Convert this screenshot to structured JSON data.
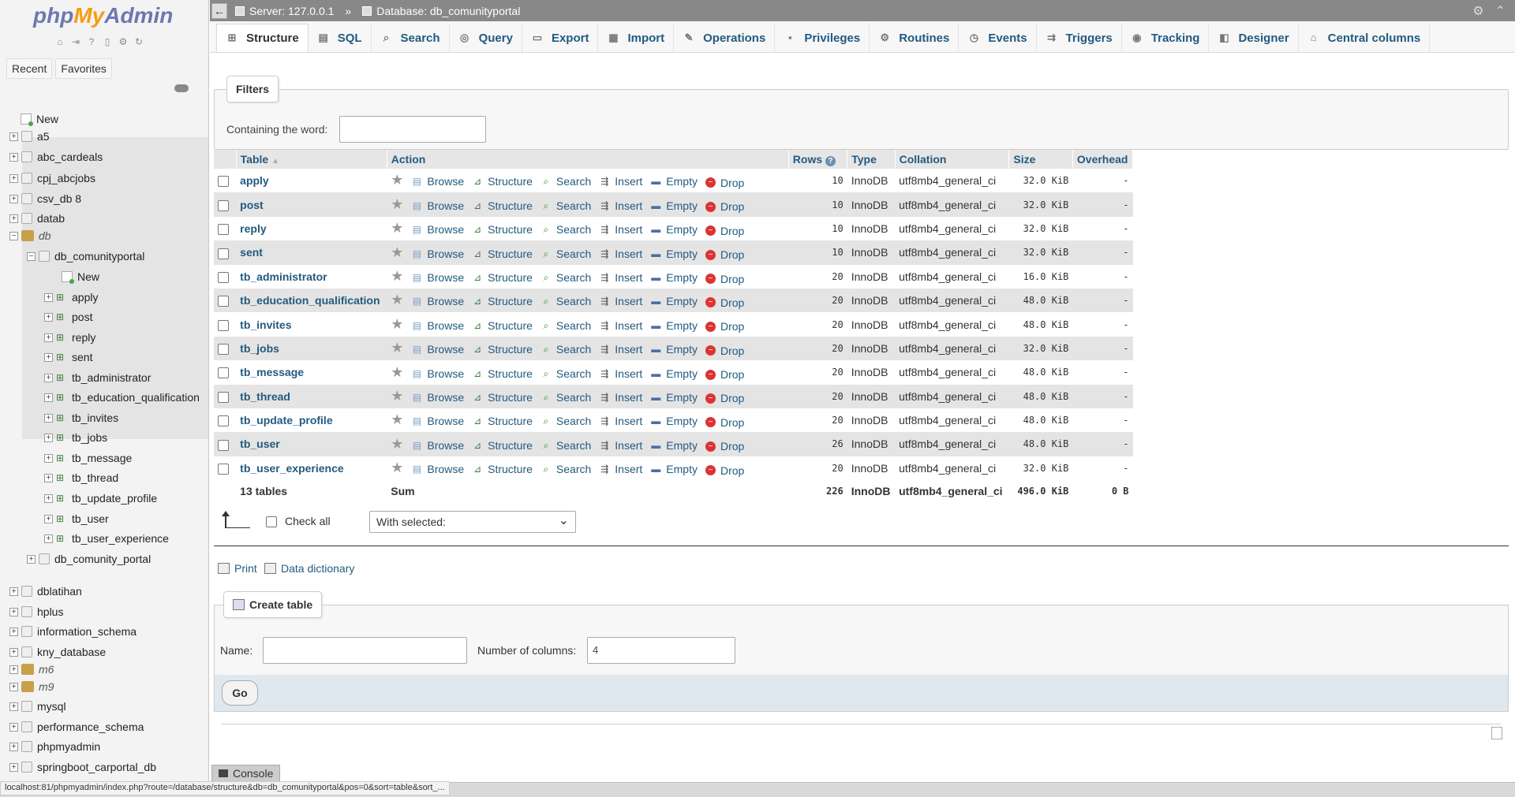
{
  "logo": {
    "part1": "php",
    "part2": "My",
    "part3": "Admin"
  },
  "sidebar": {
    "tabs": [
      "Recent",
      "Favorites"
    ],
    "tree": [
      {
        "label": "New",
        "kind": "new",
        "level": 0
      },
      {
        "label": "a5",
        "kind": "db",
        "level": 0
      },
      {
        "label": "abc_cardeals",
        "kind": "db",
        "level": 0
      },
      {
        "label": "cpj_abcjobs",
        "kind": "db",
        "level": 0
      },
      {
        "label": "csv_db 8",
        "kind": "db",
        "level": 0
      },
      {
        "label": "datab",
        "kind": "db",
        "level": 0
      },
      {
        "label": "db",
        "kind": "group",
        "level": 0
      },
      {
        "label": "db_comunityportal",
        "kind": "db-open",
        "level": 1
      },
      {
        "label": "New",
        "kind": "new",
        "level": 2
      },
      {
        "label": "apply",
        "kind": "table",
        "level": 2
      },
      {
        "label": "post",
        "kind": "table",
        "level": 2
      },
      {
        "label": "reply",
        "kind": "table",
        "level": 2
      },
      {
        "label": "sent",
        "kind": "table",
        "level": 2
      },
      {
        "label": "tb_administrator",
        "kind": "table",
        "level": 2
      },
      {
        "label": "tb_education_qualification",
        "kind": "table",
        "level": 2
      },
      {
        "label": "tb_invites",
        "kind": "table",
        "level": 2
      },
      {
        "label": "tb_jobs",
        "kind": "table",
        "level": 2
      },
      {
        "label": "tb_message",
        "kind": "table",
        "level": 2
      },
      {
        "label": "tb_thread",
        "kind": "table",
        "level": 2
      },
      {
        "label": "tb_update_profile",
        "kind": "table",
        "level": 2
      },
      {
        "label": "tb_user",
        "kind": "table",
        "level": 2
      },
      {
        "label": "tb_user_experience",
        "kind": "table",
        "level": 2
      },
      {
        "label": "db_comunity_portal",
        "kind": "db",
        "level": 1
      },
      {
        "label": "dblatihan",
        "kind": "db",
        "level": 0
      },
      {
        "label": "hplus",
        "kind": "db",
        "level": 0
      },
      {
        "label": "information_schema",
        "kind": "db",
        "level": 0
      },
      {
        "label": "kny_database",
        "kind": "db",
        "level": 0
      },
      {
        "label": "m6",
        "kind": "group",
        "level": 0
      },
      {
        "label": "m9",
        "kind": "group",
        "level": 0
      },
      {
        "label": "mysql",
        "kind": "db",
        "level": 0
      },
      {
        "label": "performance_schema",
        "kind": "db",
        "level": 0
      },
      {
        "label": "phpmyadmin",
        "kind": "db",
        "level": 0
      },
      {
        "label": "springboot_carportal_db",
        "kind": "db",
        "level": 0
      }
    ]
  },
  "topbar": {
    "server": "Server: 127.0.0.1",
    "separator": "»",
    "database": "Database: db_comunityportal"
  },
  "tabs": [
    {
      "label": "Structure",
      "icon": "structure-icon",
      "glyph": "⊞"
    },
    {
      "label": "SQL",
      "icon": "sql-icon",
      "glyph": "▤"
    },
    {
      "label": "Search",
      "icon": "search-icon",
      "glyph": "⌕"
    },
    {
      "label": "Query",
      "icon": "query-icon",
      "glyph": "◎"
    },
    {
      "label": "Export",
      "icon": "export-icon",
      "glyph": "▭"
    },
    {
      "label": "Import",
      "icon": "import-icon",
      "glyph": "▦"
    },
    {
      "label": "Operations",
      "icon": "wrench-icon",
      "glyph": "✎"
    },
    {
      "label": "Privileges",
      "icon": "privileges-icon",
      "glyph": "▪"
    },
    {
      "label": "Routines",
      "icon": "routines-icon",
      "glyph": "⚙"
    },
    {
      "label": "Events",
      "icon": "clock-icon",
      "glyph": "◷"
    },
    {
      "label": "Triggers",
      "icon": "triggers-icon",
      "glyph": "⇉"
    },
    {
      "label": "Tracking",
      "icon": "eye-icon",
      "glyph": "◉"
    },
    {
      "label": "Designer",
      "icon": "designer-icon",
      "glyph": "◧"
    },
    {
      "label": "Central columns",
      "icon": "central-columns-icon",
      "glyph": "⌂"
    }
  ],
  "filters": {
    "legend": "Filters",
    "label": "Containing the word:",
    "value": ""
  },
  "table": {
    "headers": {
      "table": "Table",
      "action": "Action",
      "rows": "Rows",
      "type": "Type",
      "collation": "Collation",
      "size": "Size",
      "overhead": "Overhead"
    },
    "actions": [
      "Browse",
      "Structure",
      "Search",
      "Insert",
      "Empty",
      "Drop"
    ],
    "rows": [
      {
        "name": "apply",
        "rows": "10",
        "type": "InnoDB",
        "collation": "utf8mb4_general_ci",
        "size": "32.0 KiB",
        "overhead": "-"
      },
      {
        "name": "post",
        "rows": "10",
        "type": "InnoDB",
        "collation": "utf8mb4_general_ci",
        "size": "32.0 KiB",
        "overhead": "-"
      },
      {
        "name": "reply",
        "rows": "10",
        "type": "InnoDB",
        "collation": "utf8mb4_general_ci",
        "size": "32.0 KiB",
        "overhead": "-"
      },
      {
        "name": "sent",
        "rows": "10",
        "type": "InnoDB",
        "collation": "utf8mb4_general_ci",
        "size": "32.0 KiB",
        "overhead": "-"
      },
      {
        "name": "tb_administrator",
        "rows": "20",
        "type": "InnoDB",
        "collation": "utf8mb4_general_ci",
        "size": "16.0 KiB",
        "overhead": "-"
      },
      {
        "name": "tb_education_qualification",
        "rows": "20",
        "type": "InnoDB",
        "collation": "utf8mb4_general_ci",
        "size": "48.0 KiB",
        "overhead": "-"
      },
      {
        "name": "tb_invites",
        "rows": "20",
        "type": "InnoDB",
        "collation": "utf8mb4_general_ci",
        "size": "48.0 KiB",
        "overhead": "-"
      },
      {
        "name": "tb_jobs",
        "rows": "20",
        "type": "InnoDB",
        "collation": "utf8mb4_general_ci",
        "size": "32.0 KiB",
        "overhead": "-"
      },
      {
        "name": "tb_message",
        "rows": "20",
        "type": "InnoDB",
        "collation": "utf8mb4_general_ci",
        "size": "48.0 KiB",
        "overhead": "-"
      },
      {
        "name": "tb_thread",
        "rows": "20",
        "type": "InnoDB",
        "collation": "utf8mb4_general_ci",
        "size": "48.0 KiB",
        "overhead": "-"
      },
      {
        "name": "tb_update_profile",
        "rows": "20",
        "type": "InnoDB",
        "collation": "utf8mb4_general_ci",
        "size": "48.0 KiB",
        "overhead": "-"
      },
      {
        "name": "tb_user",
        "rows": "26",
        "type": "InnoDB",
        "collation": "utf8mb4_general_ci",
        "size": "48.0 KiB",
        "overhead": "-"
      },
      {
        "name": "tb_user_experience",
        "rows": "20",
        "type": "InnoDB",
        "collation": "utf8mb4_general_ci",
        "size": "32.0 KiB",
        "overhead": "-"
      }
    ],
    "summary": {
      "tables": "13 tables",
      "label": "Sum",
      "rows": "226",
      "type": "InnoDB",
      "collation": "utf8mb4_general_ci",
      "size": "496.0 KiB",
      "overhead": "0 B"
    }
  },
  "bulk": {
    "check_all": "Check all",
    "with_selected": "With selected:"
  },
  "links": {
    "print": "Print",
    "data_dictionary": "Data dictionary"
  },
  "create": {
    "legend": "Create table",
    "name_label": "Name:",
    "name_value": "",
    "cols_label": "Number of columns:",
    "cols_value": "4",
    "go": "Go"
  },
  "console": {
    "label": "Console"
  },
  "status_url": "localhost:81/phpmyadmin/index.php?route=/database/structure&db=db_comunityportal&pos=0&sort=table&sort_..."
}
